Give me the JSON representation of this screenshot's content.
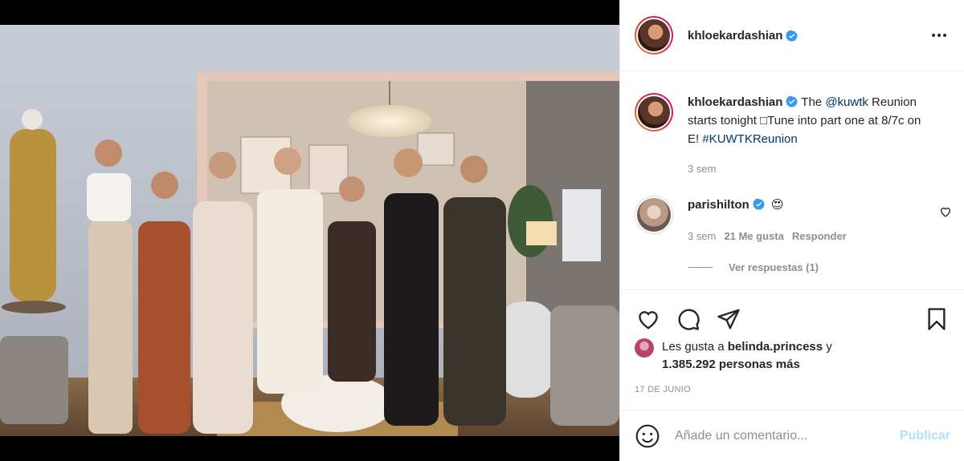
{
  "post": {
    "author": "khloekardashian",
    "author_verified": true,
    "more_icon": "more-horizontal-icon"
  },
  "caption": {
    "username": "khloekardashian",
    "text_prefix": "The ",
    "mention": "@kuwtk",
    "text_body": " Reunion starts tonight □Tune into part one at 8/7c on E! ",
    "hashtag": "#KUWTKReunion",
    "time": "3 sem"
  },
  "top_comment": {
    "username": "parishilton",
    "verified": true,
    "emoji": "😍",
    "time": "3 sem",
    "likes": "21 Me gusta",
    "reply": "Responder",
    "view_replies": "Ver respuestas (1)"
  },
  "likes": {
    "prefix": "Les gusta a ",
    "user": "belinda.princess",
    "connector": " y",
    "count": "1.385.292 personas más"
  },
  "date": "17 DE JUNIO",
  "add_comment": {
    "placeholder": "Añade un comentario...",
    "publish_label": "Publicar"
  },
  "colors": {
    "link": "#00376b",
    "verified": "#3897f0",
    "publish_disabled": "#b2dffc"
  }
}
